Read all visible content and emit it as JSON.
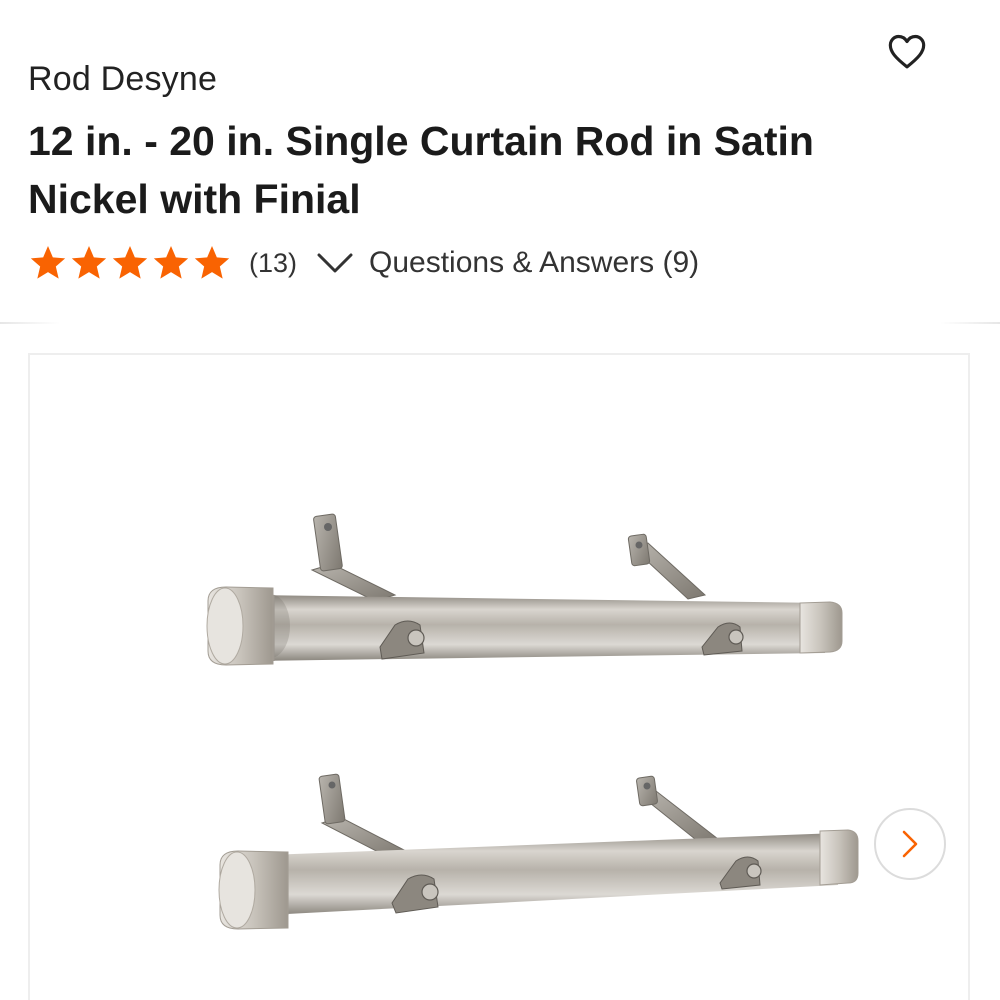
{
  "product": {
    "brand": "Rod Desyne",
    "title": "12 in. - 20 in. Single Curtain Rod in Satin Nickel with Finial",
    "rating": 5,
    "rating_max": 5,
    "review_count": "(13)",
    "qa_label": "Questions & Answers (9)"
  },
  "icons": {
    "favorite": "heart-outline-icon",
    "star": "star-filled-icon",
    "expand": "chevron-down-icon",
    "next": "chevron-right-icon"
  },
  "colors": {
    "star": "#f96302",
    "next_arrow": "#f96302",
    "text": "#1b1b1b"
  }
}
